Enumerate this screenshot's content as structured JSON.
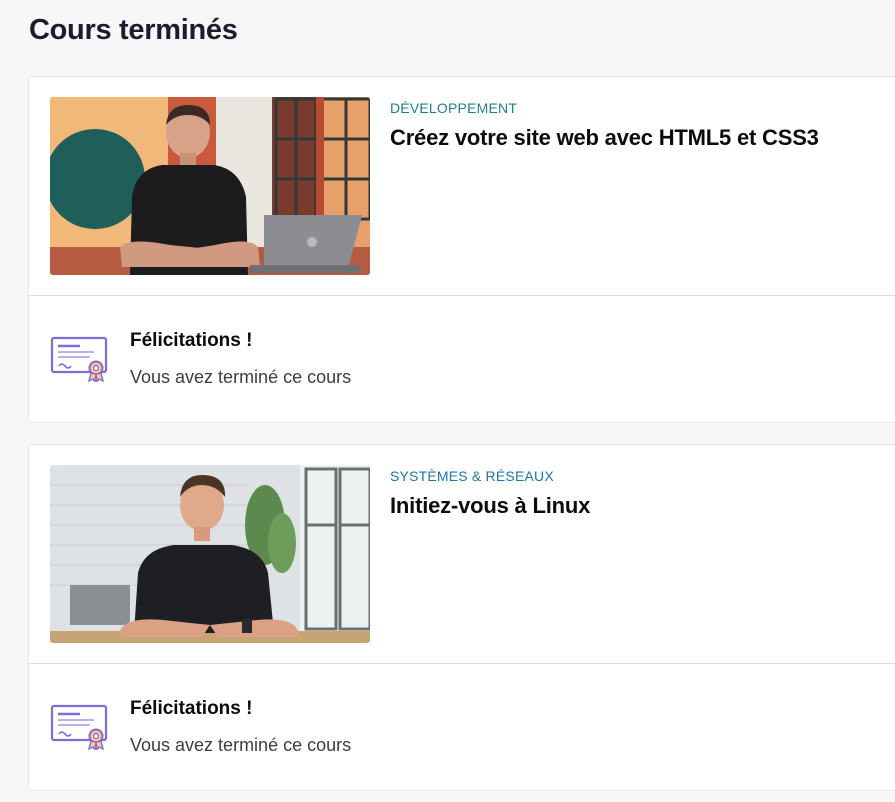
{
  "page": {
    "title": "Cours terminés"
  },
  "courses": [
    {
      "category": "DÉVELOPPEMENT",
      "title": "Créez votre site web avec HTML5 et CSS3",
      "congrats": "Félicitations !",
      "status": "Vous avez terminé ce cours",
      "category_color": "#1f7f85"
    },
    {
      "category": "SYSTÈMES & RÉSEAUX",
      "title": "Initiez-vous à Linux",
      "congrats": "Félicitations !",
      "status": "Vous avez terminé ce cours",
      "category_color": "#1f74a8"
    }
  ],
  "colors": {
    "accent_purple": "#7b6ed6",
    "background": "#f7f7f8"
  }
}
